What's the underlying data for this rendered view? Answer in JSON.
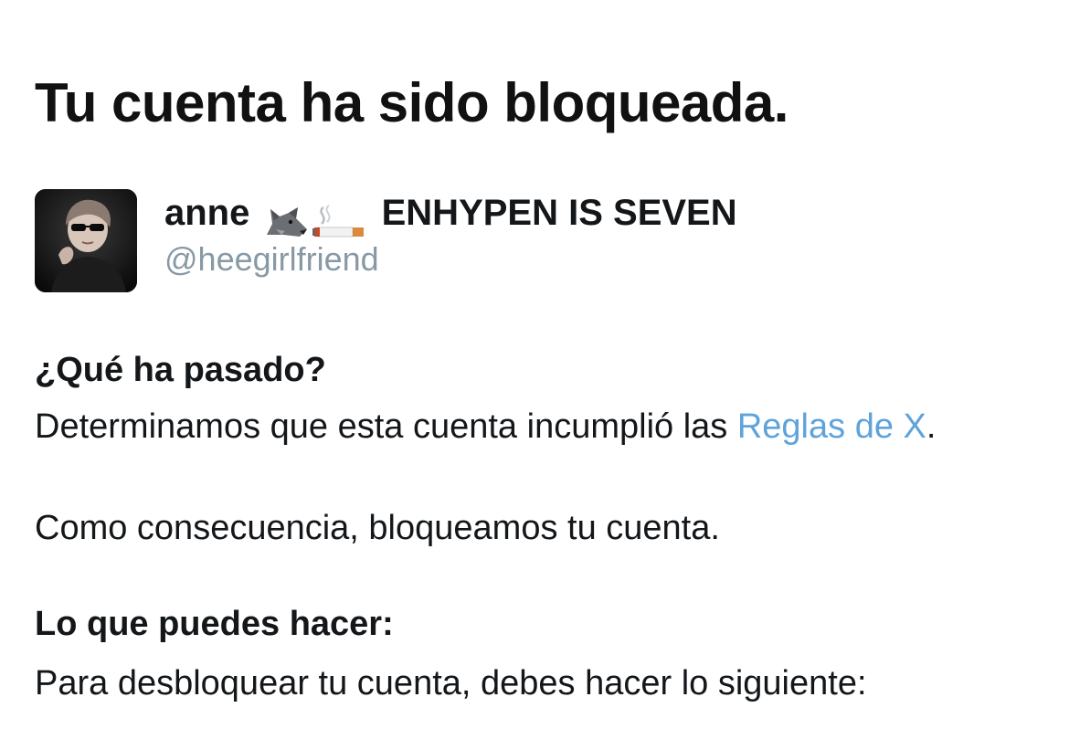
{
  "title": "Tu cuenta ha sido bloqueada.",
  "account": {
    "name_prefix": "anne",
    "name_emojis": [
      "wolf-emoji",
      "cigarette-emoji"
    ],
    "name_suffix": "ENHYPEN IS SEVEN",
    "handle": "@heegirlfriend"
  },
  "what_happened": {
    "heading": "¿Qué ha pasado?",
    "text_before_link": "Determinamos que esta cuenta incumplió las ",
    "link_text": "Reglas de X",
    "text_after_link": ".",
    "consequence": "Como consecuencia, bloqueamos tu cuenta."
  },
  "what_you_can_do": {
    "heading": "Lo que puedes hacer:",
    "text": "Para desbloquear tu cuenta, debes hacer lo siguiente:"
  },
  "colors": {
    "link": "#5fa3db",
    "handle": "#8899a6",
    "text": "#14171a"
  }
}
